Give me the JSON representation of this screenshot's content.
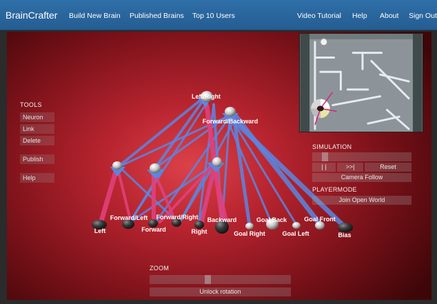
{
  "brand": "BrainCrafter",
  "nav": {
    "left": [
      "Build New Brain",
      "Published Brains",
      "Top 10 Users"
    ],
    "right": [
      "Video Tutorial",
      "Help",
      "About",
      "Sign Out"
    ]
  },
  "tools": {
    "title": "TOOLS",
    "buttons": [
      "Neuron",
      "Link",
      "Delete",
      "Publish",
      "Help"
    ]
  },
  "simulation": {
    "title": "SIMULATION",
    "speed_level": 0.1,
    "pause_label": "| |",
    "fast_forward_label": ">>|",
    "reset_label": "Reset",
    "camera_follow_label": "Camera Follow"
  },
  "playermode": {
    "title": "PLAYERMODE",
    "join_label": "Join Open World"
  },
  "zoom": {
    "title": "ZOOM",
    "level": 0.41,
    "unlock_label": "Unlock rotation"
  },
  "neuron_labels": {
    "left_right": "Left/Right",
    "forward_backward": "Forward/Backward",
    "forward_left": "Forward/Left",
    "forward_right": "Forward/Right",
    "backward": "Backward",
    "goal_back": "Goal Back",
    "goal_front": "Goal Front",
    "left": "Left",
    "forward": "Forward",
    "right": "Right",
    "goal_right": "Goal Right",
    "goal_left": "Goal Left",
    "bias": "Bias"
  },
  "colors": {
    "navbar": "#2f6fa8",
    "excitatory_link": "#5b86e0",
    "inhibitory_link": "#e0407a"
  }
}
